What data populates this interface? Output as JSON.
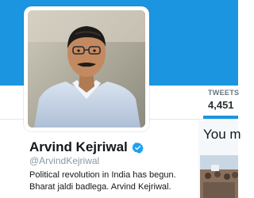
{
  "colors": {
    "banner": "#1b95e0",
    "accent": "#1b95e0",
    "verified_badge": "#1da1f2"
  },
  "stats": {
    "tweets_label": "TWEETS",
    "tweets_value": "4,451"
  },
  "profile": {
    "name": "Arvind Kejriwal",
    "verified_icon": "verified-badge-icon",
    "handle": "@ArvindKejriwal",
    "bio_lines": [
      "Political revolution in India has begun.",
      "Bharat jaldi badlega. Arvind Kejriwal."
    ]
  },
  "right_panel": {
    "heading": "You m"
  }
}
